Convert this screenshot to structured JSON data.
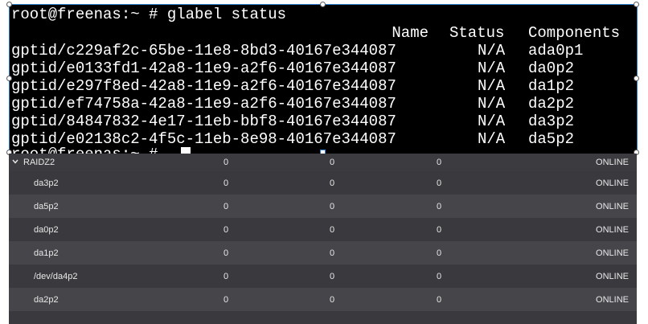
{
  "terminal": {
    "prompt": "root@freenas:~ # glabel status",
    "headers": {
      "name": "Name",
      "status": "Status",
      "components": "Components"
    },
    "rows": [
      {
        "name": "gptid/c229af2c-65be-11e8-8bd3-40167e344087",
        "status": "N/A",
        "component": "ada0p1"
      },
      {
        "name": "gptid/e0133fd1-42a8-11e9-a2f6-40167e344087",
        "status": "N/A",
        "component": "da0p2"
      },
      {
        "name": "gptid/e297f8ed-42a8-11e9-a2f6-40167e344087",
        "status": "N/A",
        "component": "da1p2"
      },
      {
        "name": "gptid/ef74758a-42a8-11e9-a2f6-40167e344087",
        "status": "N/A",
        "component": "da2p2"
      },
      {
        "name": "gptid/84847832-4e17-11eb-bbf8-40167e344087",
        "status": "N/A",
        "component": "da3p2"
      },
      {
        "name": "gptid/e02138c2-4f5c-11eb-8e98-40167e344087",
        "status": "N/A",
        "component": "da5p2"
      }
    ],
    "next_prompt": "root@freenas:~ #"
  },
  "pool": {
    "vdev": {
      "name": "RAIDZ2",
      "read": "0",
      "write": "0",
      "checksum": "0",
      "status": "ONLINE"
    },
    "disks": [
      {
        "name": "da3p2",
        "read": "0",
        "write": "0",
        "checksum": "0",
        "status": "ONLINE"
      },
      {
        "name": "da5p2",
        "read": "0",
        "write": "0",
        "checksum": "0",
        "status": "ONLINE"
      },
      {
        "name": "da0p2",
        "read": "0",
        "write": "0",
        "checksum": "0",
        "status": "ONLINE"
      },
      {
        "name": "da1p2",
        "read": "0",
        "write": "0",
        "checksum": "0",
        "status": "ONLINE"
      },
      {
        "name": "/dev/da4p2",
        "read": "0",
        "write": "0",
        "checksum": "0",
        "status": "ONLINE"
      },
      {
        "name": "da2p2",
        "read": "0",
        "write": "0",
        "checksum": "0",
        "status": "ONLINE"
      }
    ]
  },
  "icons": {
    "expand": "chevron-down-icon"
  },
  "colors": {
    "terminal_bg": "#000000",
    "terminal_fg": "#ffffff",
    "table_bg": "#3a3a3e",
    "table_alt": "#45454a",
    "selection": "#2f7fd0"
  }
}
